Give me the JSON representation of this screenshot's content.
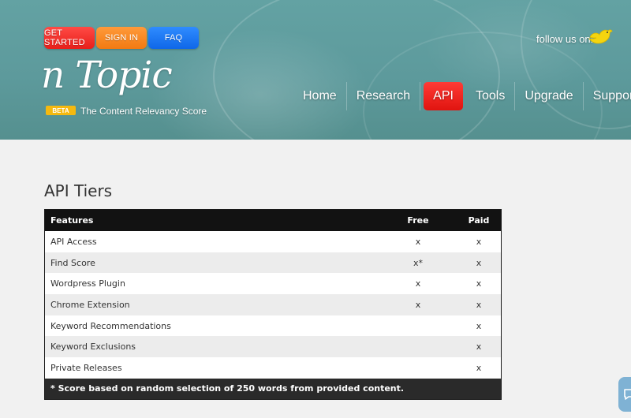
{
  "header": {
    "buttons": {
      "get_started": "GET STARTED",
      "sign_in": "SIGN IN",
      "faq": "FAQ"
    },
    "follow_us": "follow us on:",
    "logo": {
      "text": "n Topic",
      "beta": "BETA",
      "tagline": "The Content Relevancy Score"
    },
    "nav": [
      "Home",
      "Research",
      "API",
      "Tools",
      "Upgrade",
      "Support"
    ],
    "nav_active": "API"
  },
  "main": {
    "title": "API Tiers",
    "table": {
      "headers": [
        "Features",
        "Free",
        "Paid"
      ],
      "rows": [
        {
          "feature": "API Access",
          "free": "x",
          "paid": "x"
        },
        {
          "feature": "Find Score",
          "free": "x*",
          "paid": "x"
        },
        {
          "feature": "Wordpress Plugin",
          "free": "x",
          "paid": "x"
        },
        {
          "feature": "Chrome Extension",
          "free": "x",
          "paid": "x"
        },
        {
          "feature": "Keyword Recommendations",
          "free": "",
          "paid": "x"
        },
        {
          "feature": "Keyword Exclusions",
          "free": "",
          "paid": "x"
        },
        {
          "feature": "Private Releases",
          "free": "",
          "paid": "x"
        }
      ],
      "footnote": "* Score based on random selection of 250 words from provided content."
    }
  },
  "colors": {
    "header_bg": "#5d9a9c",
    "active_nav": "#e81f1a",
    "get_started": "#e81f1a",
    "sign_in": "#f27a12",
    "faq": "#0f67e8",
    "table_header": "#121212"
  },
  "icons": {
    "social": "bird-icon",
    "chat": "chat-icon"
  }
}
